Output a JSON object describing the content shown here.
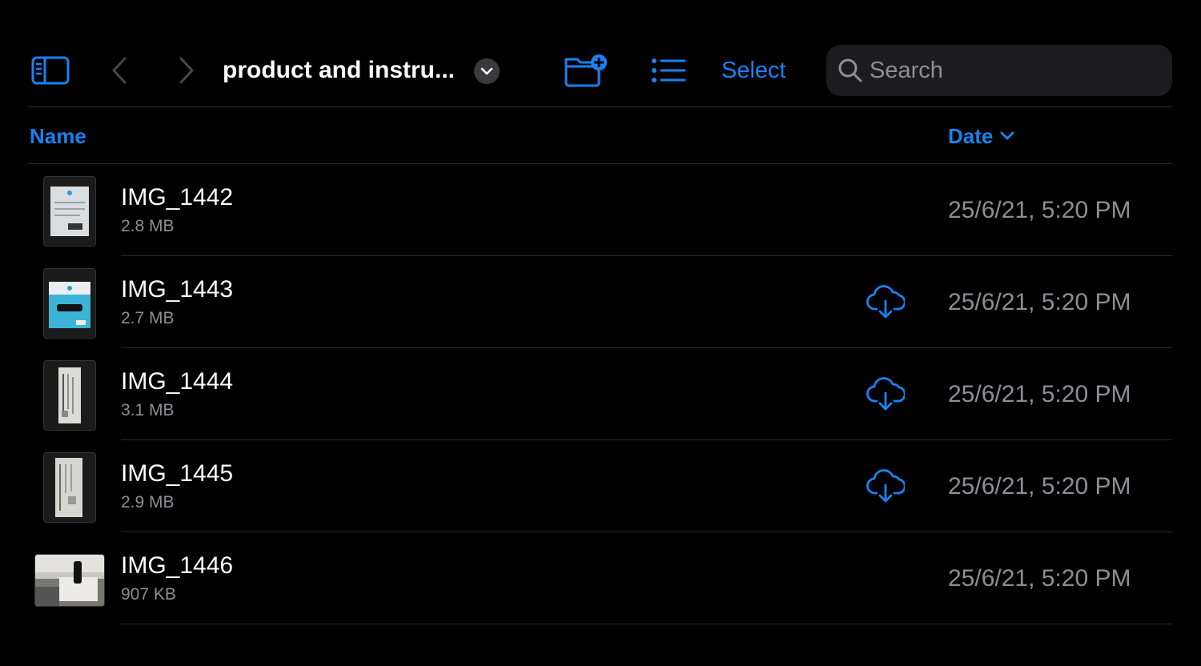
{
  "toolbar": {
    "folder_title": "product and instru...",
    "select_label": "Select",
    "icons": {
      "sidebar": "sidebar-icon",
      "back": "chevron-left-icon",
      "forward": "chevron-right-icon",
      "title_menu": "chevron-down-circle-icon",
      "new_folder": "folder-plus-icon",
      "view_list": "list-icon"
    }
  },
  "search": {
    "placeholder": "Search",
    "value": ""
  },
  "columns": {
    "name_label": "Name",
    "date_label": "Date"
  },
  "colors": {
    "accent": "#1a82f0",
    "background": "#000000",
    "secondary_text": "#8e8e93"
  },
  "files": [
    {
      "name": "IMG_1442",
      "size": "2.8 MB",
      "date": "25/6/21, 5:20 PM",
      "in_cloud": false
    },
    {
      "name": "IMG_1443",
      "size": "2.7 MB",
      "date": "25/6/21, 5:20 PM",
      "in_cloud": true
    },
    {
      "name": "IMG_1444",
      "size": "3.1 MB",
      "date": "25/6/21, 5:20 PM",
      "in_cloud": true
    },
    {
      "name": "IMG_1445",
      "size": "2.9 MB",
      "date": "25/6/21, 5:20 PM",
      "in_cloud": true
    },
    {
      "name": "IMG_1446",
      "size": "907 KB",
      "date": "25/6/21, 5:20 PM",
      "in_cloud": false
    }
  ]
}
